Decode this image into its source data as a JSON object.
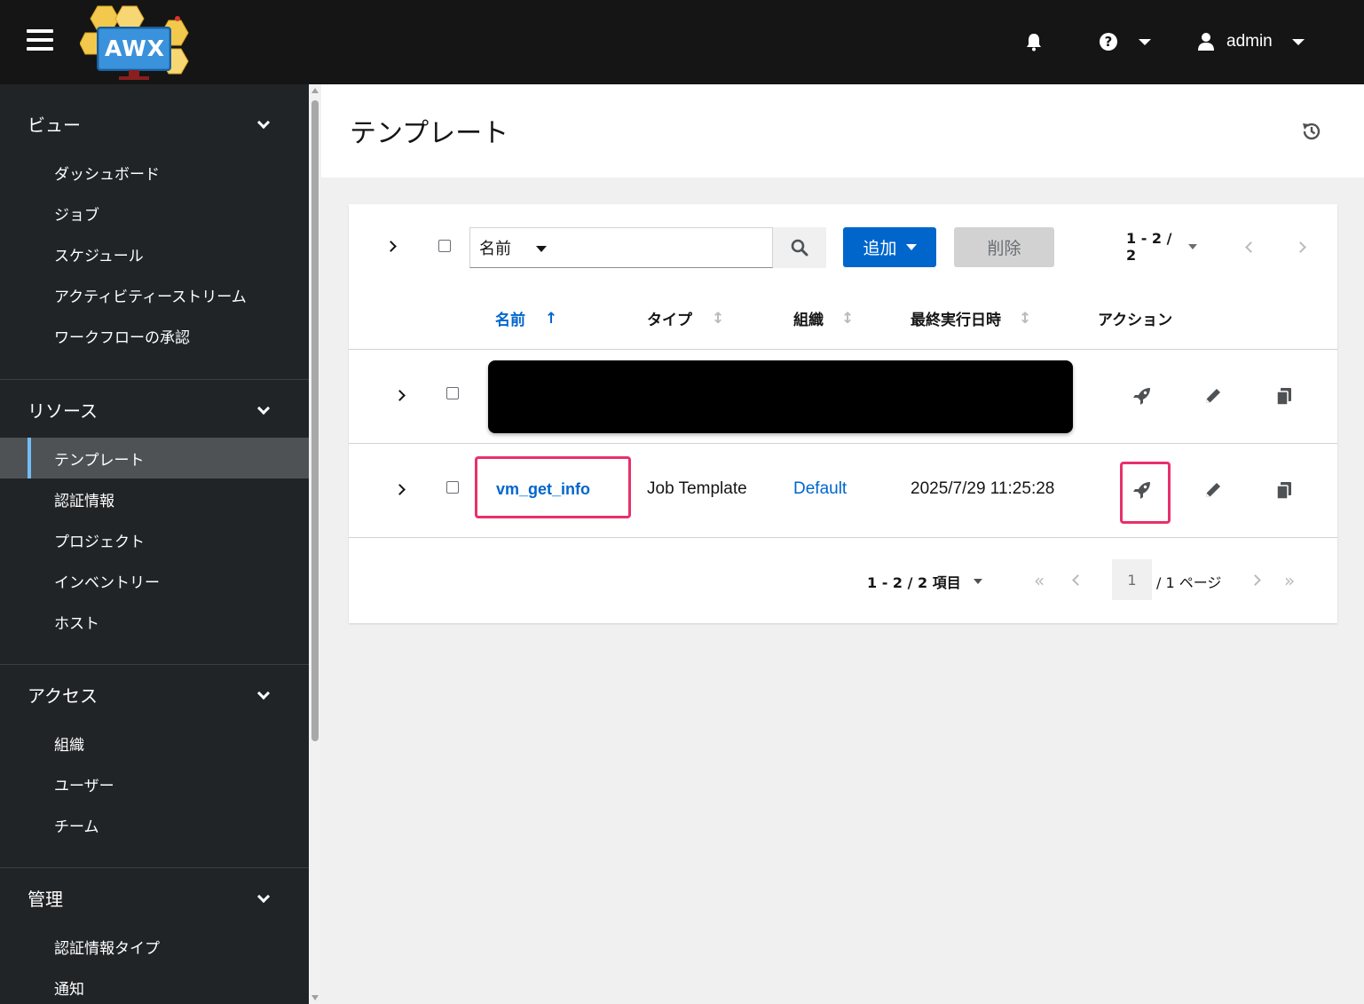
{
  "header": {
    "logo_text": "AWX",
    "user_name": "admin",
    "icons": [
      "hamburger-icon",
      "bell-icon",
      "question-circle-icon",
      "user-icon"
    ]
  },
  "sidebar": {
    "groups": [
      {
        "title": "ビュー",
        "items": [
          "ダッシュボード",
          "ジョブ",
          "スケジュール",
          "アクティビティーストリーム",
          "ワークフローの承認"
        ]
      },
      {
        "title": "リソース",
        "items": [
          "テンプレート",
          "認証情報",
          "プロジェクト",
          "インベントリー",
          "ホスト"
        ],
        "active": "テンプレート"
      },
      {
        "title": "アクセス",
        "items": [
          "組織",
          "ユーザー",
          "チーム"
        ]
      },
      {
        "title": "管理",
        "items": [
          "認証情報タイプ",
          "通知"
        ]
      }
    ]
  },
  "page": {
    "title": "テンプレート"
  },
  "toolbar": {
    "filter_field": "名前",
    "search_value": "",
    "add_label": "追加",
    "delete_label": "削除",
    "pagination_top": "1 - 2 / 2"
  },
  "table": {
    "columns": [
      {
        "label": "名前",
        "sort": "ascending"
      },
      {
        "label": "タイプ",
        "sort": "none"
      },
      {
        "label": "組織",
        "sort": "none"
      },
      {
        "label": "最終実行日時",
        "sort": "none"
      },
      {
        "label": "アクション"
      }
    ],
    "rows": [
      {
        "name": "[redacted]",
        "type": "",
        "organization": "",
        "last_run": "",
        "redacted": true
      },
      {
        "name": "vm_get_info",
        "type": "Job Template",
        "organization": "Default",
        "last_run": "2025/7/29 11:25:28",
        "highlighted": true
      }
    ]
  },
  "pagination_bottom": {
    "items_text": "1 - 2 / 2 項目",
    "page_value": "1",
    "page_total": "/ 1 ページ"
  },
  "colors": {
    "masthead": "#151515",
    "sidebar": "#212427",
    "primary": "#0066cc",
    "highlight": "#e8306a",
    "active_nav_border": "#73bcf7"
  }
}
